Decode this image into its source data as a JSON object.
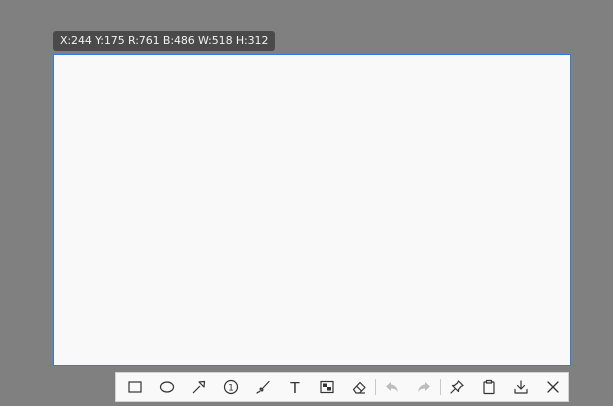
{
  "tooltip": {
    "text": "X:244 Y:175 R:761 B:486 W:518 H:312"
  },
  "colors": {
    "overlay": "#808080",
    "selection_border": "#2f7be0",
    "icon": "#333333",
    "icon_disabled": "#bcbcbc"
  },
  "toolbar": {
    "tools": [
      {
        "name": "rectangle-icon"
      },
      {
        "name": "ellipse-icon"
      },
      {
        "name": "arrow-icon"
      },
      {
        "name": "number-marker-icon",
        "label": "1"
      },
      {
        "name": "pen-icon"
      },
      {
        "name": "text-icon",
        "label": "T"
      },
      {
        "name": "mosaic-icon"
      },
      {
        "name": "eraser-icon"
      },
      {
        "name": "undo-icon",
        "state": "disabled"
      },
      {
        "name": "redo-icon",
        "state": "disabled"
      },
      {
        "name": "pin-icon"
      },
      {
        "name": "clipboard-icon"
      },
      {
        "name": "save-icon"
      },
      {
        "name": "close-icon"
      }
    ]
  }
}
